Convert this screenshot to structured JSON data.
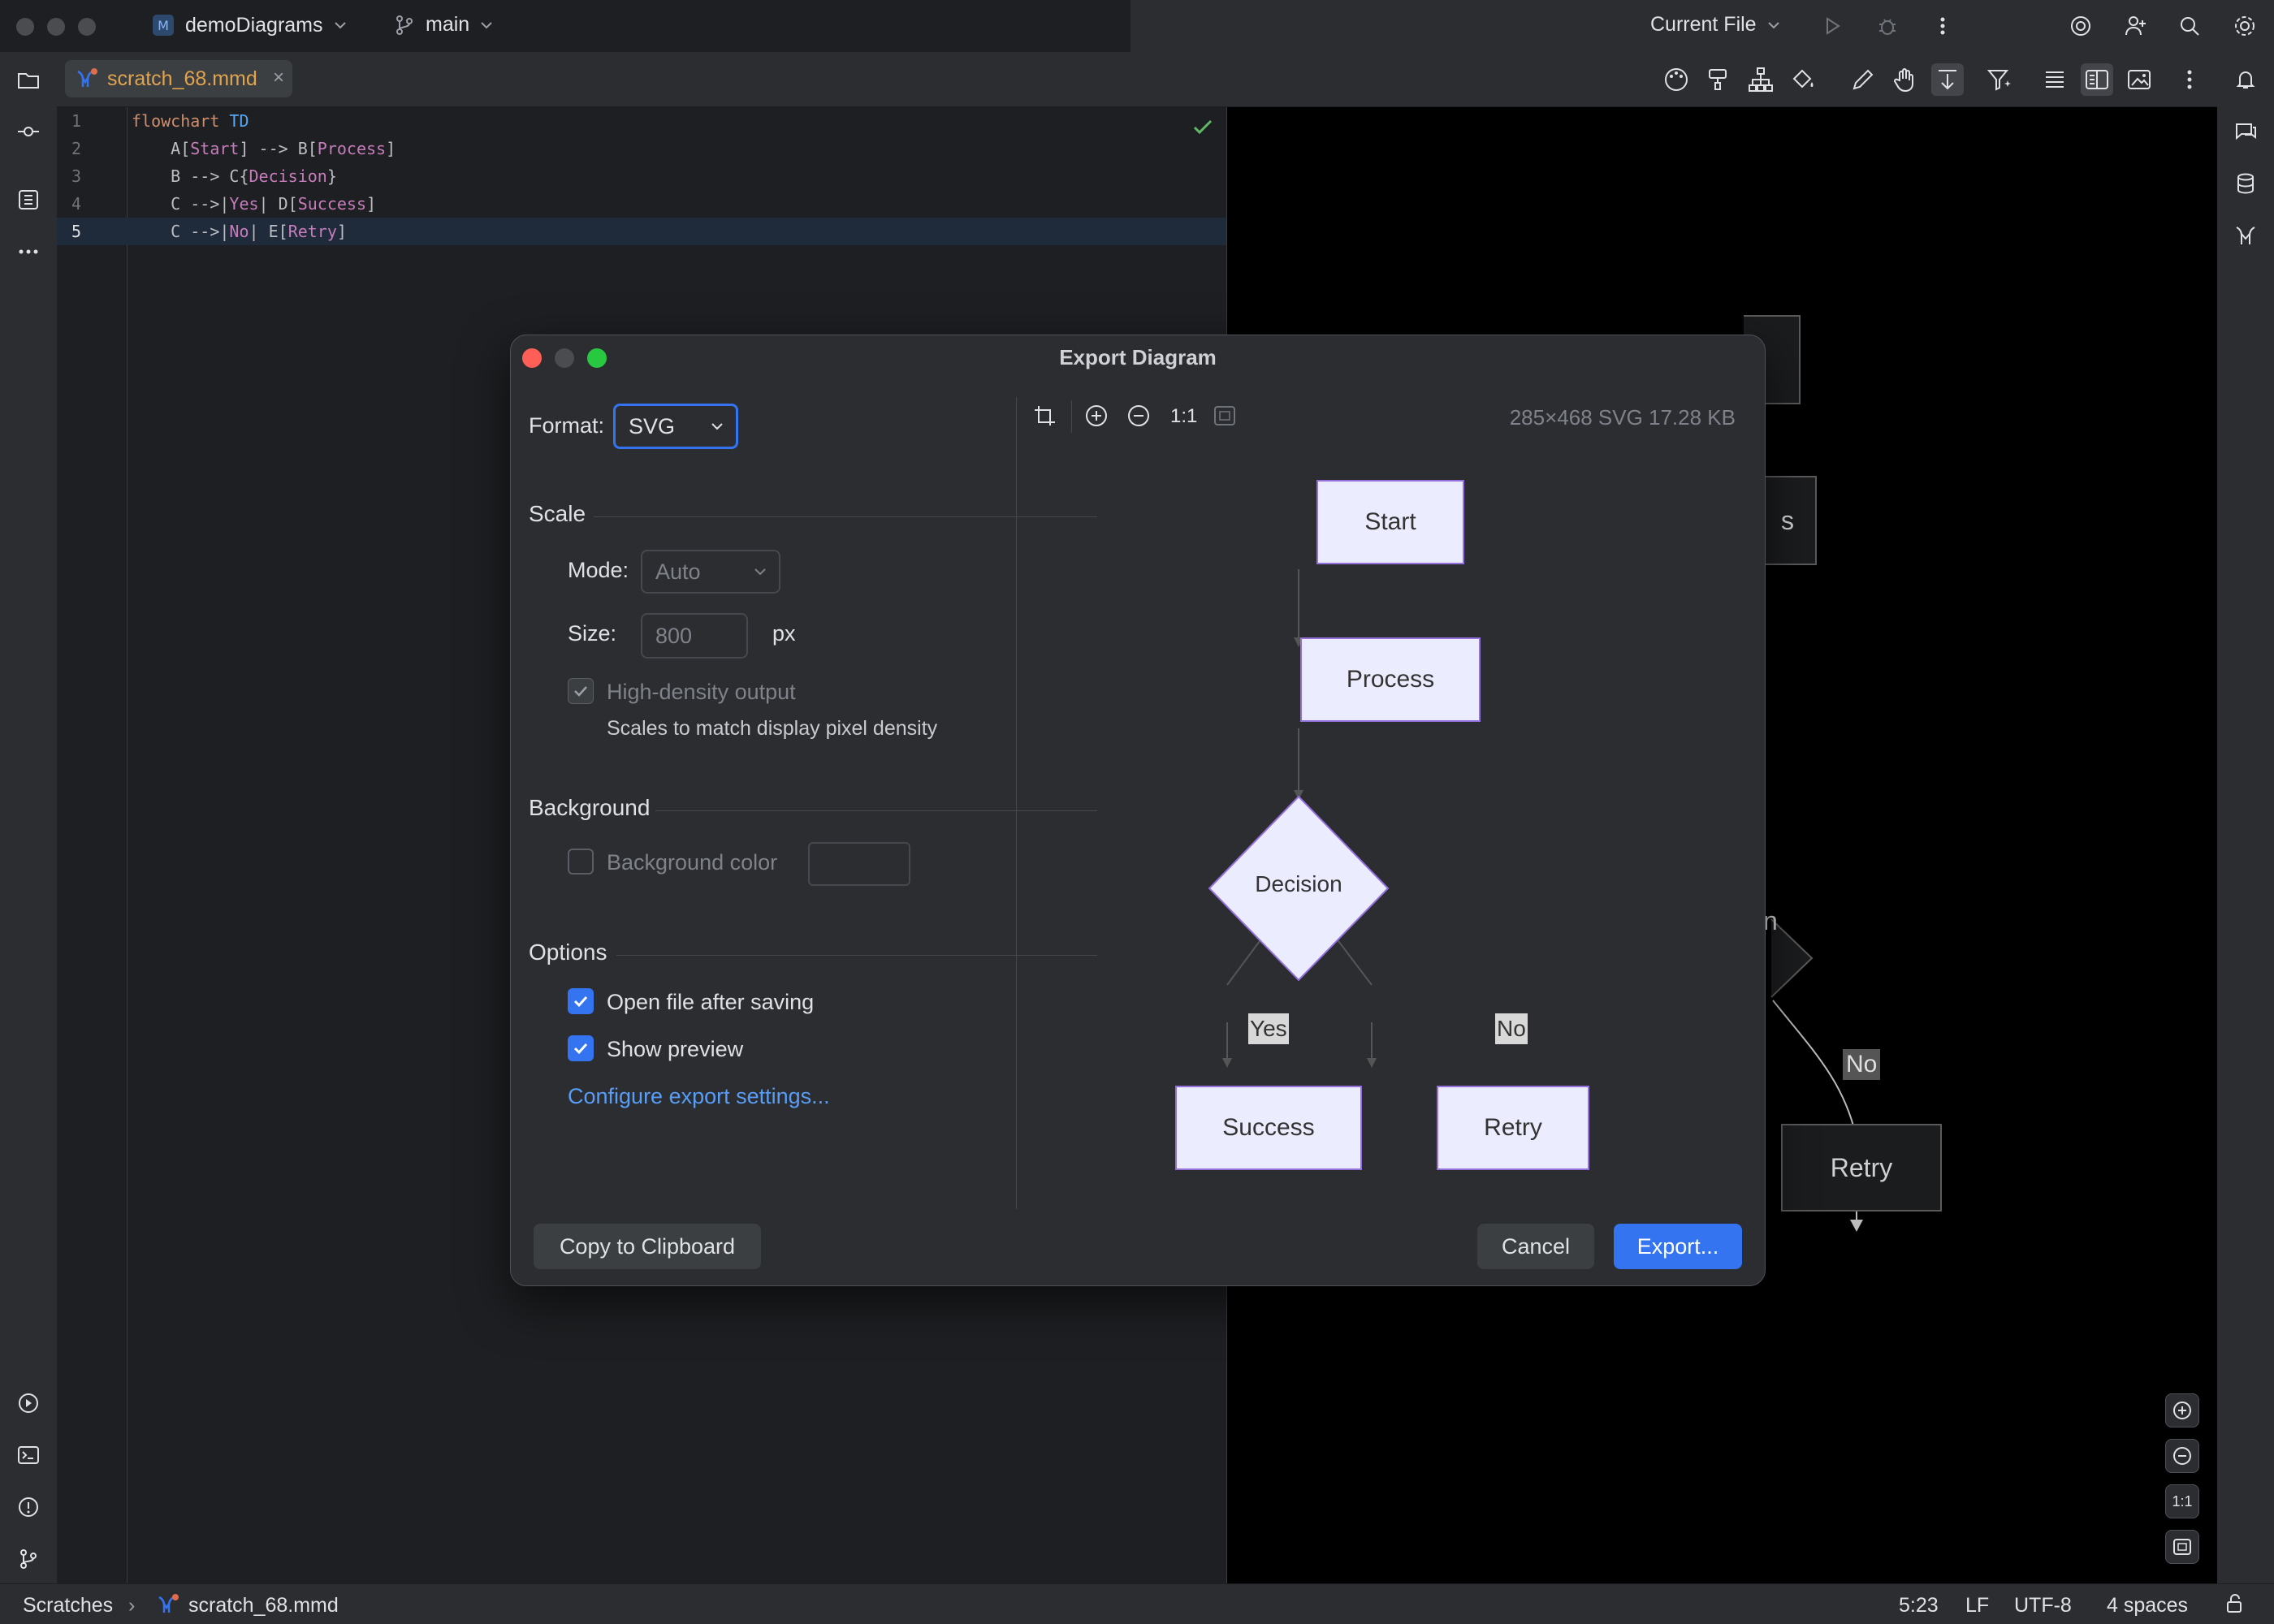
{
  "titlebar": {
    "project": "demoDiagrams",
    "branch": "main",
    "run_config": "Current File"
  },
  "editor_tab": {
    "filename": "scratch_68.mmd",
    "close_glyph": "×"
  },
  "editor": {
    "lines": [
      {
        "n": "1",
        "tokens": [
          {
            "t": "flowchart ",
            "c": "kw"
          },
          {
            "t": "TD",
            "c": "kw2"
          }
        ]
      },
      {
        "n": "2",
        "tokens": [
          {
            "t": "    A[",
            "c": "id"
          },
          {
            "t": "Start",
            "c": "lbl"
          },
          {
            "t": "] --> B[",
            "c": "id"
          },
          {
            "t": "Process",
            "c": "lbl"
          },
          {
            "t": "]",
            "c": "id"
          }
        ]
      },
      {
        "n": "3",
        "tokens": [
          {
            "t": "    B --> C{",
            "c": "id"
          },
          {
            "t": "Decision",
            "c": "lbl"
          },
          {
            "t": "}",
            "c": "id"
          }
        ]
      },
      {
        "n": "4",
        "tokens": [
          {
            "t": "    C -->|",
            "c": "id"
          },
          {
            "t": "Yes",
            "c": "lbl"
          },
          {
            "t": "| D[",
            "c": "id"
          },
          {
            "t": "Success",
            "c": "lbl"
          },
          {
            "t": "]",
            "c": "id"
          }
        ]
      },
      {
        "n": "5",
        "tokens": [
          {
            "t": "    C -->|",
            "c": "id"
          },
          {
            "t": "No",
            "c": "lbl"
          },
          {
            "t": "| E[",
            "c": "id"
          },
          {
            "t": "Retry",
            "c": "lbl"
          },
          {
            "t": "]",
            "c": "id"
          }
        ]
      }
    ]
  },
  "background_preview": {
    "partial_process": "s",
    "partial_decision": "n",
    "edge_no": "No",
    "retry": "Retry",
    "zoom_reset": "1:1"
  },
  "dialog": {
    "title": "Export Diagram",
    "format_label": "Format:",
    "format_value": "SVG",
    "scale_section": "Scale",
    "mode_label": "Mode:",
    "mode_value": "Auto",
    "size_label": "Size:",
    "size_value": "800",
    "size_unit": "px",
    "hidpi_label": "High-density output",
    "hidpi_hint": "Scales to match display pixel density",
    "background_section": "Background",
    "bgcolor_label": "Background color",
    "options_section": "Options",
    "open_after_label": "Open file after saving",
    "show_preview_label": "Show preview",
    "configure_link": "Configure export settings...",
    "copy_button": "Copy to Clipboard",
    "cancel_button": "Cancel",
    "export_button": "Export...",
    "preview": {
      "zoom_reset": "1:1",
      "info": "285×468 SVG 17.28 KB",
      "nodes": {
        "start": "Start",
        "process": "Process",
        "decision": "Decision",
        "success": "Success",
        "retry": "Retry"
      },
      "edge_yes": "Yes",
      "edge_no": "No"
    }
  },
  "statusbar": {
    "scope": "Scratches",
    "separator": "›",
    "file": "scratch_68.mmd",
    "position": "5:23",
    "line_sep": "LF",
    "encoding": "UTF-8",
    "indent": "4 spaces"
  },
  "colors": {
    "accent": "#3574f0",
    "link": "#589df6",
    "node_fill": "#ececff",
    "node_border": "#9370db"
  }
}
